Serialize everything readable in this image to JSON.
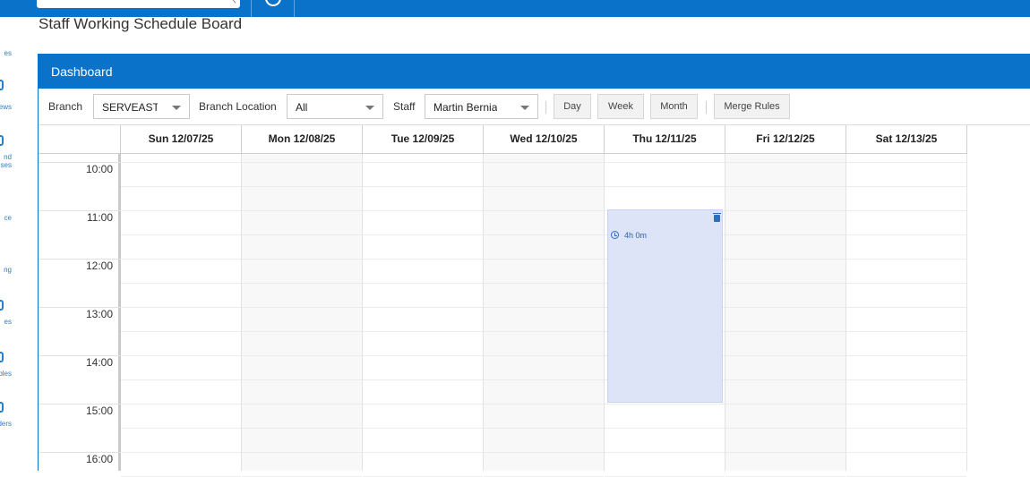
{
  "page": {
    "title": "Staff Working Schedule Board"
  },
  "sidenav": {
    "items": [
      {
        "label": "es"
      },
      {
        "label": "ews"
      },
      {
        "label": "nd\nses"
      },
      {
        "label": "ce"
      },
      {
        "label": "ng"
      },
      {
        "label": "es"
      },
      {
        "label": "bles"
      },
      {
        "label": "ders"
      }
    ]
  },
  "panel": {
    "title": "Dashboard"
  },
  "toolbar": {
    "branch_label": "Branch",
    "branch_value": "SERVEAST",
    "location_label": "Branch Location",
    "location_value": "All",
    "staff_label": "Staff",
    "staff_value": "Martin Bernia",
    "day_button": "Day",
    "week_button": "Week",
    "month_button": "Month",
    "merge_button": "Merge Rules"
  },
  "calendar": {
    "days": [
      "Sun 12/07/25",
      "Mon 12/08/25",
      "Tue 12/09/25",
      "Wed 12/10/25",
      "Thu 12/11/25",
      "Fri 12/12/25",
      "Sat 12/13/25"
    ],
    "times": [
      "10:00",
      "11:00",
      "12:00",
      "13:00",
      "14:00",
      "15:00",
      "16:00"
    ],
    "event": {
      "day_index": 4,
      "start": "11:00",
      "duration_label": "4h 0m",
      "duration_hours": 4
    }
  },
  "colors": {
    "primary": "#0a72c8",
    "event_bg": "#dde4f7",
    "event_text": "#2f5fa8"
  },
  "icons": [
    "search-icon",
    "history-icon",
    "clock-icon",
    "trash-icon",
    "chevron-down-icon"
  ]
}
